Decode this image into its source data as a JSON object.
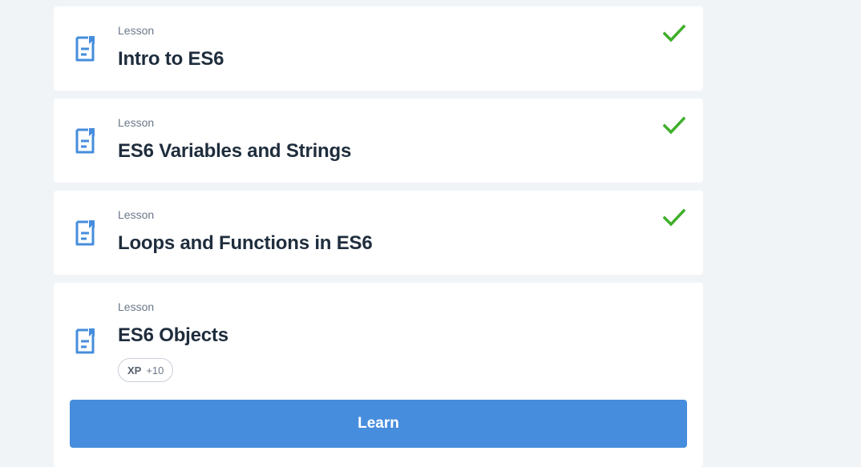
{
  "colors": {
    "background": "#f1f4f7",
    "card": "#ffffff",
    "accent": "#468ddd",
    "check": "#3fae2a",
    "title_text": "#1f2d3d",
    "muted_text": "#6b7889"
  },
  "lessons": [
    {
      "kind": "Lesson",
      "title": "Intro to ES6",
      "status": "completed",
      "icon": "document-icon"
    },
    {
      "kind": "Lesson",
      "title": "ES6 Variables and Strings",
      "status": "completed",
      "icon": "document-icon"
    },
    {
      "kind": "Lesson",
      "title": "Loops and Functions in ES6",
      "status": "completed",
      "icon": "document-icon"
    },
    {
      "kind": "Lesson",
      "title": "ES6 Objects",
      "status": "current",
      "icon": "document-icon",
      "xp": {
        "label": "XP",
        "value": "+10"
      },
      "button_label": "Learn"
    }
  ]
}
